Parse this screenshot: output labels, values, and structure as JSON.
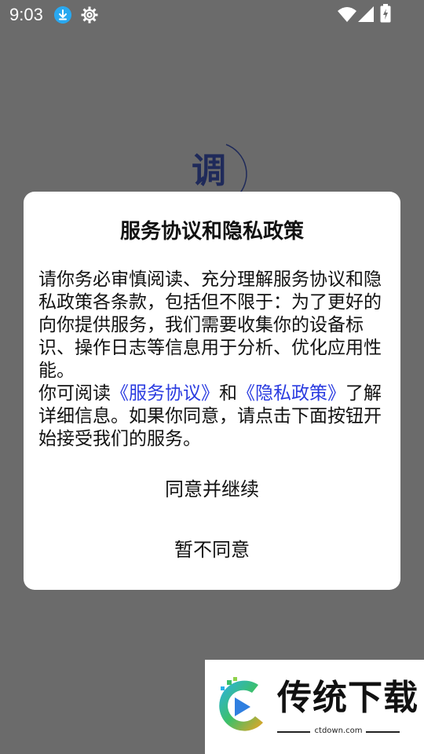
{
  "status_bar": {
    "time": "9:03",
    "icons": [
      "download-icon",
      "gear-icon",
      "wifi-icon",
      "signal-icon",
      "battery-charging-icon"
    ]
  },
  "background": {
    "logo_char": "调"
  },
  "dialog": {
    "title": "服务协议和隐私政策",
    "body_p1": "请你务必审慎阅读、充分理解服务协议和隐私政策各条款，包括但不限于：为了更好的向你提供服务，我们需要收集你的设备标识、操作日志等信息用于分析、优化应用性能。",
    "body_p2_prefix": "你可阅读",
    "link_service": "《服务协议》",
    "body_p2_and": "和",
    "link_privacy": "《隐私政策》",
    "body_p2_suffix": "了解详细信息。如果你同意，请点击下面按钮开始接受我们的服务。",
    "agree_button": "同意并继续",
    "decline_button": "暂不同意"
  },
  "watermark": {
    "name": "传统下载",
    "domain": "ctdown.com"
  },
  "colors": {
    "overlay": "#6b6b6b",
    "link": "#2a3be0",
    "download_badge": "#29a8f0",
    "logo_text": "#1f2a5a"
  }
}
